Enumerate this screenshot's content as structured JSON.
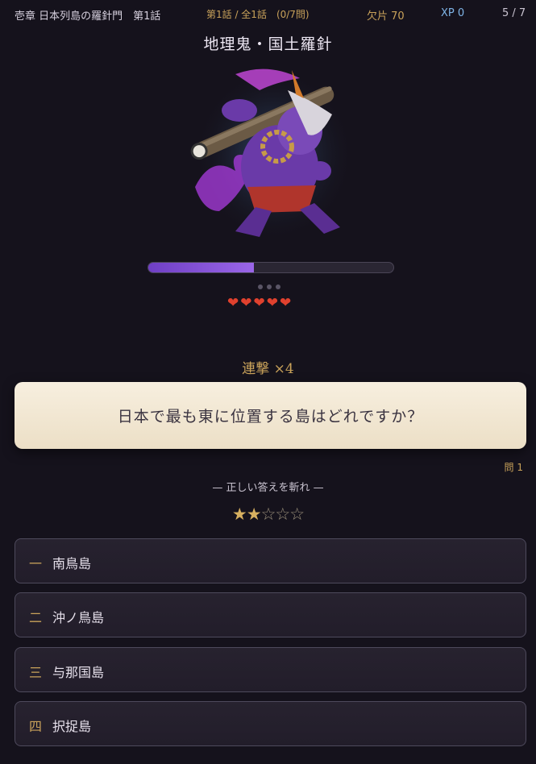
{
  "header": {
    "chapter": "壱章 日本列島の羅針門　第1話",
    "episode": "第1話 / 全1話　(0/7問)",
    "fragments": "欠片 70",
    "xp": "XP 0",
    "page": "5 / 7"
  },
  "enemy": {
    "name": "地理鬼・国土羅針",
    "hp_fraction": 0.43,
    "hearts": "❤❤❤❤❤"
  },
  "combo": "連撃 ×4",
  "question": {
    "text": "日本で最も東に位置する島はどれですか？",
    "number": "問 1"
  },
  "instruction": "— 正しい答えを斬れ —",
  "difficulty": {
    "filled": "★★",
    "empty": "☆☆☆"
  },
  "answers": [
    {
      "num": "一",
      "label": "南鳥島"
    },
    {
      "num": "二",
      "label": "沖ノ鳥島"
    },
    {
      "num": "三",
      "label": "与那国島"
    },
    {
      "num": "四",
      "label": "択捉島"
    }
  ],
  "colors": {
    "background": "#15121c",
    "accent_gold": "#c9a25a",
    "xp_blue": "#7fb4e6",
    "hp_purple": "#8a55dc",
    "heart_red": "#e0412e"
  }
}
